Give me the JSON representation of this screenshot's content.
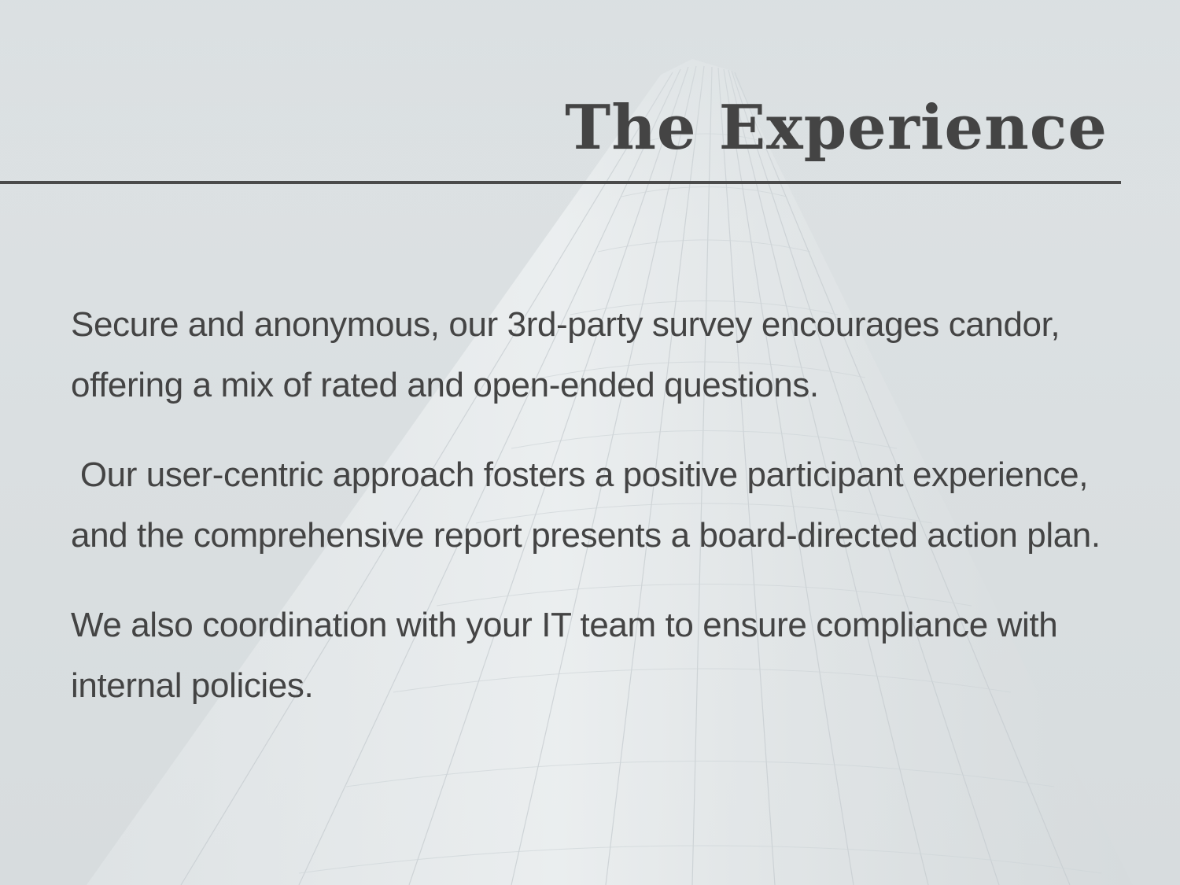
{
  "slide": {
    "title": "The Experience",
    "background_image": "skyscraper-photo",
    "colors": {
      "background": "#d9dfe1",
      "text": "#444444",
      "rule": "#4a4a4a"
    }
  },
  "body": {
    "paragraphs": [
      "Secure and anonymous, our 3rd-party survey encourages candor, offering a mix of rated and open-ended questions.",
      " Our user-centric approach fosters a positive participant experience, and the comprehensive report presents a board-directed action plan.",
      "We also coordination with your IT team to ensure compliance with internal policies."
    ]
  }
}
